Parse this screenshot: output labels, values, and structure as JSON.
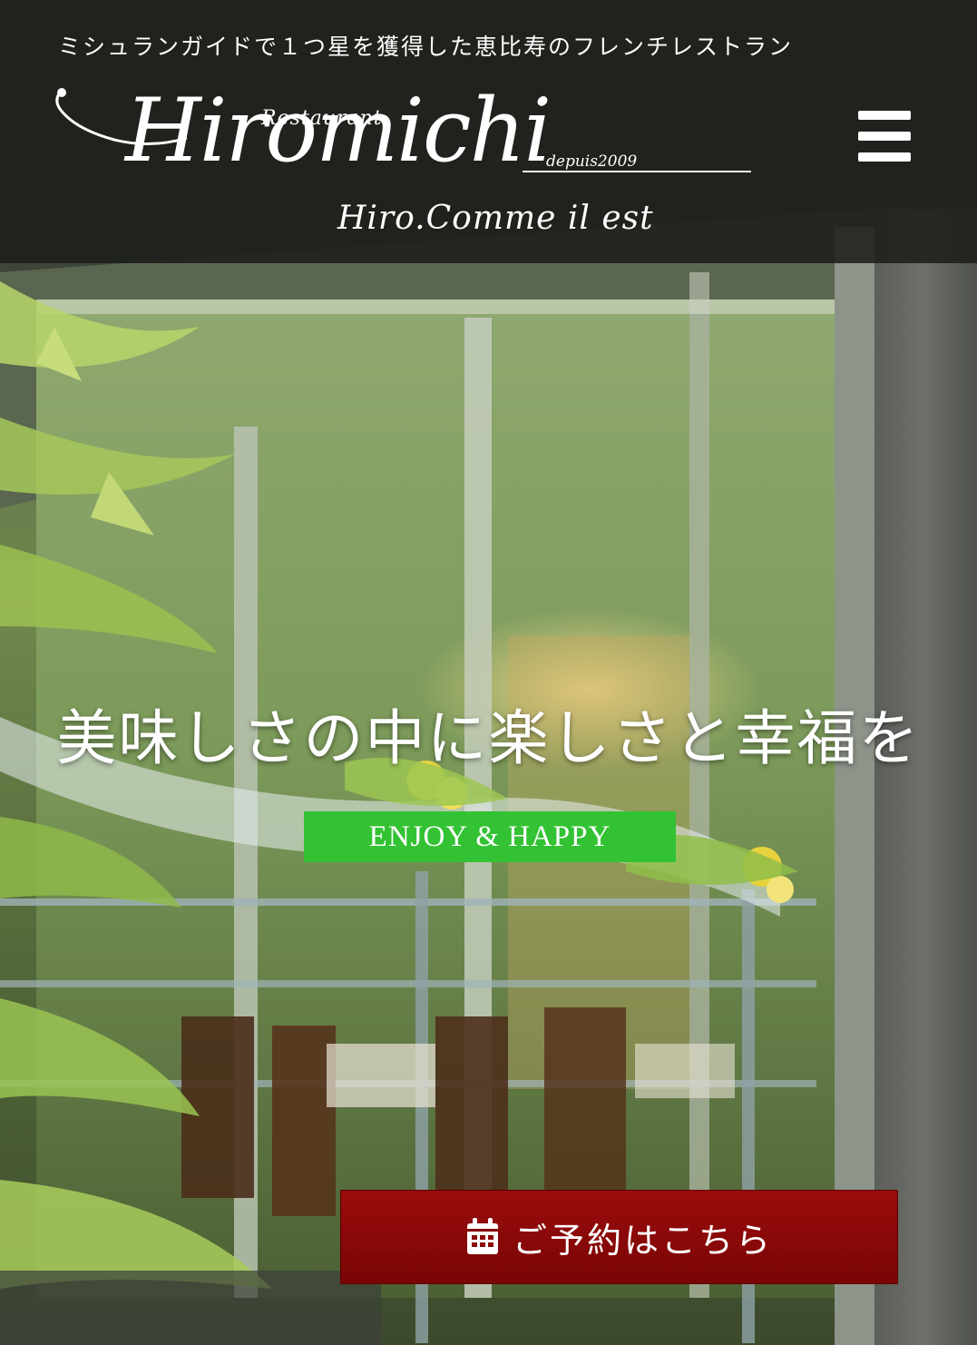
{
  "header": {
    "tagline": "ミシュランガイドで１つ星を獲得した恵比寿のフレンチレストラン",
    "logo": {
      "restaurant": "Restaurant",
      "name": "Hiromichi",
      "since": "depuis2009",
      "subtitle": "Hiro.Comme il est"
    },
    "menu_icon": "hamburger-icon"
  },
  "hero": {
    "headline": "美味しさの中に楽しさと幸福を",
    "badge": "ENJOY & HAPPY"
  },
  "reservation": {
    "label": "ご予約はこちら",
    "icon": "calendar-icon"
  },
  "colors": {
    "header_bg": "#1c1c18",
    "badge": "#33c233",
    "reserve": "#8a0808",
    "text": "#ffffff"
  }
}
